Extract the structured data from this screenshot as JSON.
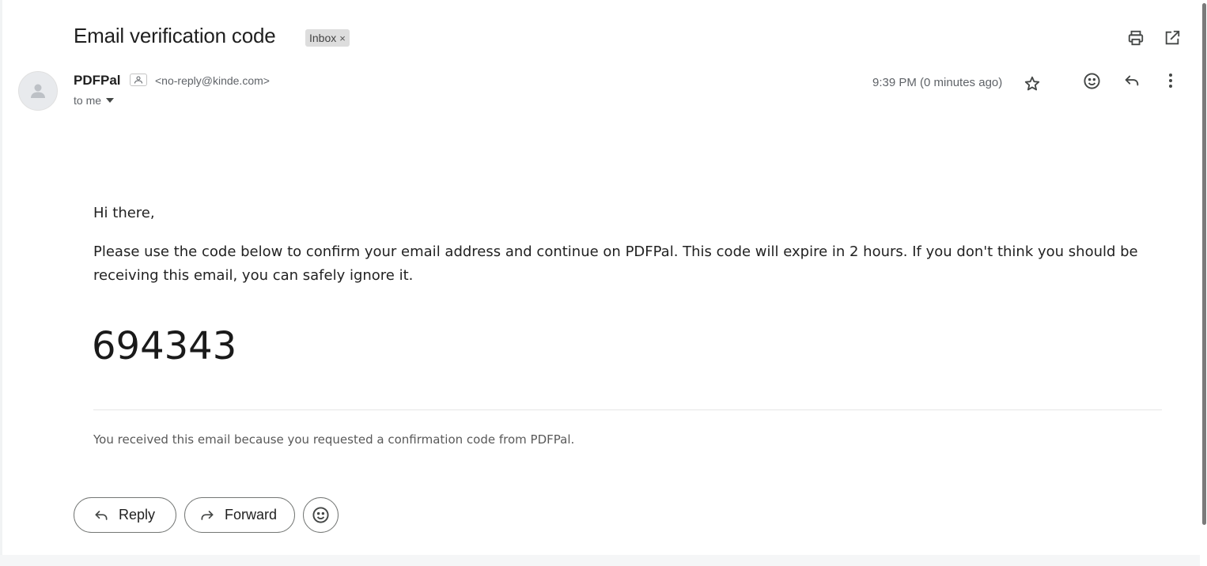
{
  "email": {
    "subject": "Email verification code",
    "label": "Inbox",
    "label_remove": "×",
    "sender_name": "PDFPal",
    "sender_email": "<no-reply@kinde.com>",
    "recipient": "to me",
    "timestamp": "9:39 PM (0 minutes ago)",
    "body": {
      "greeting": "Hi there,",
      "message": "Please use the code below to confirm your email address and continue on PDFPal. This code will expire in 2 hours. If you don't think you should be receiving this email, you can safely ignore it.",
      "code": "694343",
      "footer": "You received this email because you requested a confirmation code from PDFPal."
    }
  },
  "actions": {
    "reply_label": "Reply",
    "forward_label": "Forward"
  },
  "icons": {
    "print": "print-icon",
    "open_new_window": "open-in-new-icon",
    "star": "star-icon",
    "emoji": "emoji-icon",
    "reply": "reply-icon",
    "more": "more-vert-icon",
    "avatar": "person-icon",
    "dropdown": "caret-down-icon"
  },
  "colors": {
    "text": "#1f1f1f",
    "secondary_text": "#5f6368",
    "chip_bg": "#dddddd",
    "divider": "#e6e6e6"
  }
}
